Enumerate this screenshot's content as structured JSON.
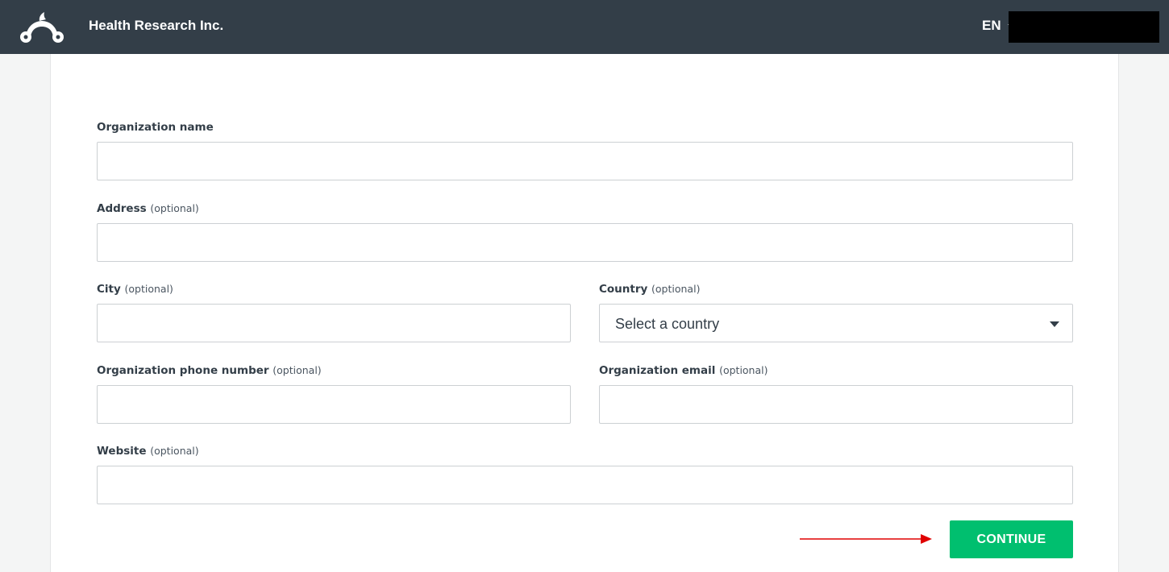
{
  "header": {
    "org_name": "Health Research Inc.",
    "language": "EN",
    "logo_icon": "surveymonkey-logo-icon",
    "account_redacted": true
  },
  "form": {
    "org_name": {
      "label": "Organization name",
      "value": ""
    },
    "address": {
      "label": "Address",
      "optional": "(optional)",
      "value": ""
    },
    "city": {
      "label": "City",
      "optional": "(optional)",
      "value": ""
    },
    "country": {
      "label": "Country",
      "optional": "(optional)",
      "selected": "Select a country"
    },
    "phone": {
      "label": "Organization phone number",
      "optional": "(optional)",
      "value": ""
    },
    "email": {
      "label": "Organization email",
      "optional": "(optional)",
      "value": ""
    },
    "website": {
      "label": "Website",
      "optional": "(optional)",
      "value": ""
    },
    "continue_label": "CONTINUE"
  },
  "colors": {
    "header_bg": "#333e48",
    "accent": "#00bf6f",
    "annotation_arrow": "#e00000"
  }
}
